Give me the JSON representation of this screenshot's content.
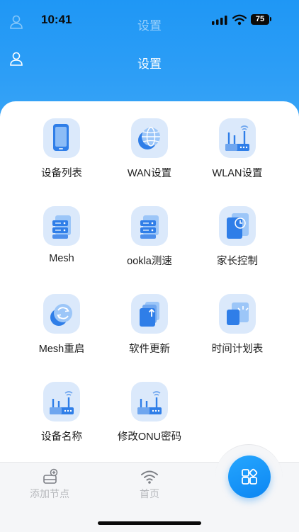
{
  "status_bar": {
    "time": "10:41",
    "battery": "75"
  },
  "header": {
    "title": "设置",
    "ghost_title": "设置"
  },
  "grid": [
    {
      "id": "device-list",
      "label": "设备列表",
      "icon": "phone-icon"
    },
    {
      "id": "wan-settings",
      "label": "WAN设置",
      "icon": "globe-icon"
    },
    {
      "id": "wlan-settings",
      "label": "WLAN设置",
      "icon": "router-icon"
    },
    {
      "id": "mesh",
      "label": "Mesh",
      "icon": "server-icon"
    },
    {
      "id": "ookla-speedtest",
      "label": "ookla测速",
      "icon": "server-icon"
    },
    {
      "id": "parental-control",
      "label": "家长控制",
      "icon": "tablet-clock-icon"
    },
    {
      "id": "mesh-restart",
      "label": "Mesh重启",
      "icon": "restart-icon"
    },
    {
      "id": "software-update",
      "label": "软件更新",
      "icon": "upload-icon"
    },
    {
      "id": "schedule",
      "label": "时间计划表",
      "icon": "schedule-icon"
    },
    {
      "id": "device-name",
      "label": "设备名称",
      "icon": "router-icon"
    },
    {
      "id": "modify-onu-password",
      "label": "修改ONU密码",
      "icon": "router-icon"
    }
  ],
  "tabbar": {
    "add_node": "添加节点",
    "home": "首页"
  },
  "colors": {
    "brand": "#1f97f5",
    "icon_bg": "#dbe9fb",
    "icon_fg": "#2f7ee8"
  }
}
